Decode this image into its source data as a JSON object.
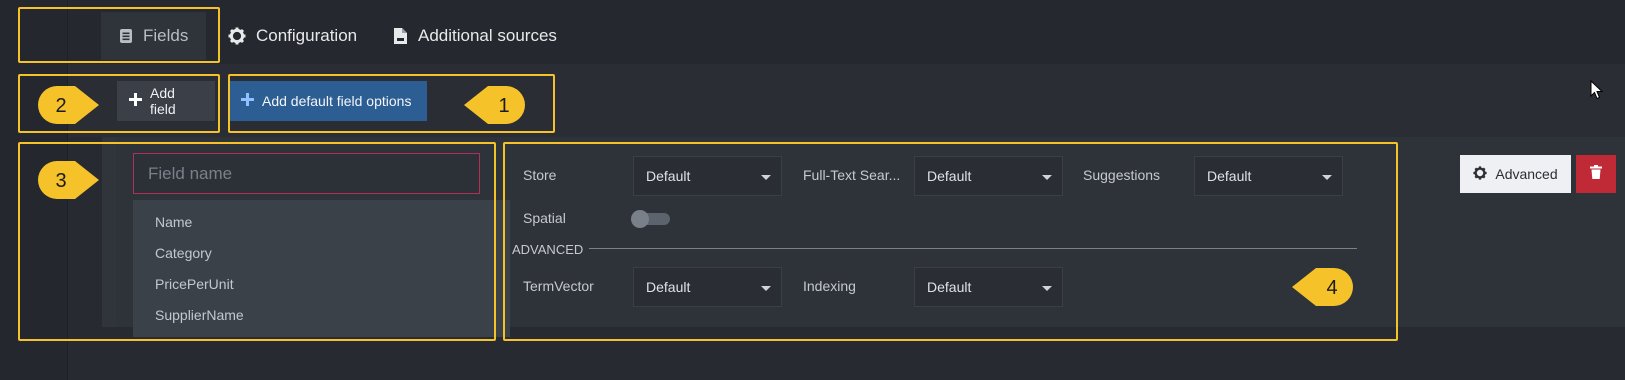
{
  "tabs": [
    {
      "label": "Fields",
      "icon": "list-icon",
      "active": true
    },
    {
      "label": "Configuration",
      "icon": "gear-icon",
      "active": false
    },
    {
      "label": "Additional sources",
      "icon": "file-icon",
      "active": false
    }
  ],
  "toolbar": {
    "add_field": "Add field",
    "add_default": "Add default field options"
  },
  "field": {
    "name_placeholder": "Field name",
    "suggestions": [
      "Name",
      "Category",
      "PricePerUnit",
      "SupplierName"
    ]
  },
  "options": {
    "store_label": "Store",
    "store_value": "Default",
    "fts_label": "Full-Text Sear...",
    "fts_value": "Default",
    "suggestions_label": "Suggestions",
    "suggestions_value": "Default",
    "spatial_label": "Spatial",
    "spatial_on": false,
    "advanced_section": "ADVANCED",
    "termvector_label": "TermVector",
    "termvector_value": "Default",
    "indexing_label": "Indexing",
    "indexing_value": "Default"
  },
  "actions": {
    "advanced": "Advanced",
    "delete_icon": "trash-icon"
  },
  "callouts": [
    "1",
    "2",
    "3",
    "4"
  ],
  "colors": {
    "highlight": "#f5c22a",
    "primary_button": "#2d5e93",
    "danger": "#c02a36",
    "input_border": "#b22f58"
  }
}
